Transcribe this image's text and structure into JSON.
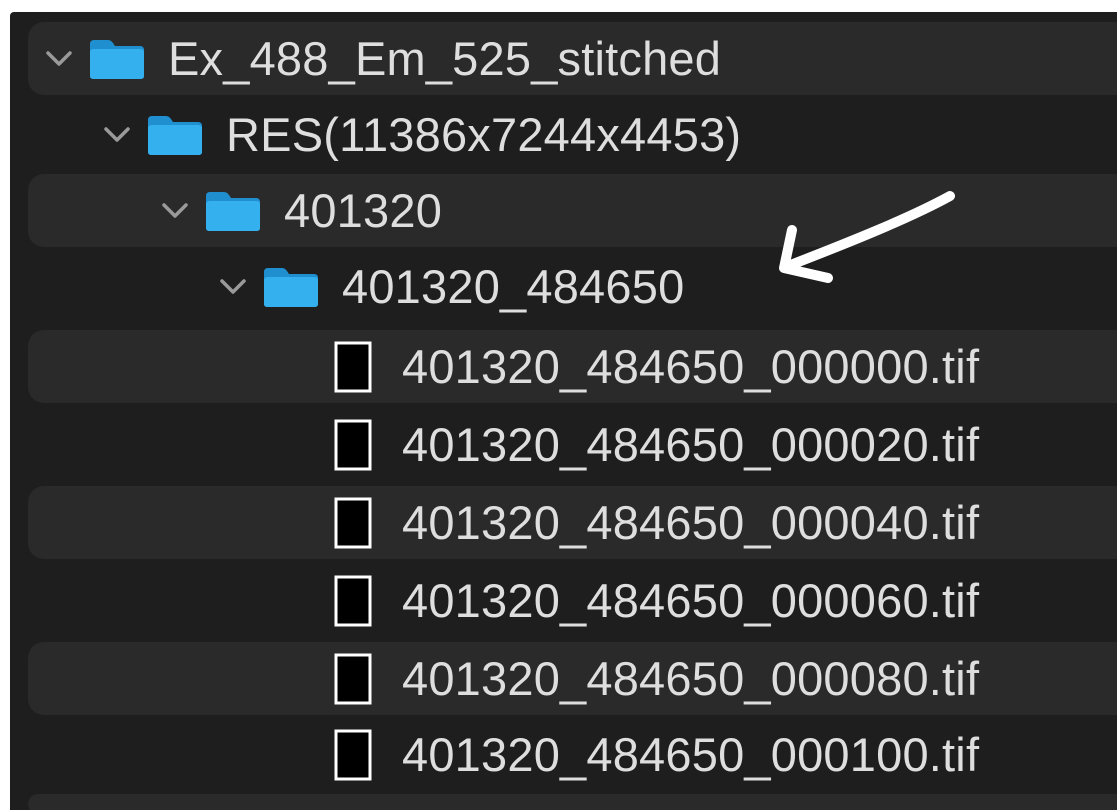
{
  "tree": {
    "root": {
      "label": "Ex_488_Em_525_stitched",
      "expanded": true
    },
    "resolution": {
      "label": "RES(11386x7244x4453)",
      "expanded": true
    },
    "folder_a": {
      "label": "401320",
      "expanded": true
    },
    "folder_b": {
      "label": "401320_484650",
      "expanded": true
    },
    "files": [
      {
        "label": "401320_484650_000000.tif"
      },
      {
        "label": "401320_484650_000020.tif"
      },
      {
        "label": "401320_484650_000040.tif"
      },
      {
        "label": "401320_484650_000060.tif"
      },
      {
        "label": "401320_484650_000080.tif"
      },
      {
        "label": "401320_484650_000100.tif"
      }
    ]
  },
  "annotation": {
    "type": "arrow",
    "color": "#ffffff"
  },
  "colors": {
    "background": "#1e1e1e",
    "row_alt": "#2a2a2a",
    "text": "#dedede",
    "folder": "#2aa9e8",
    "chevron": "#9a9a9a"
  },
  "icons": {
    "folder": "folder-icon",
    "file": "file-icon",
    "chevron": "chevron-down-icon"
  }
}
